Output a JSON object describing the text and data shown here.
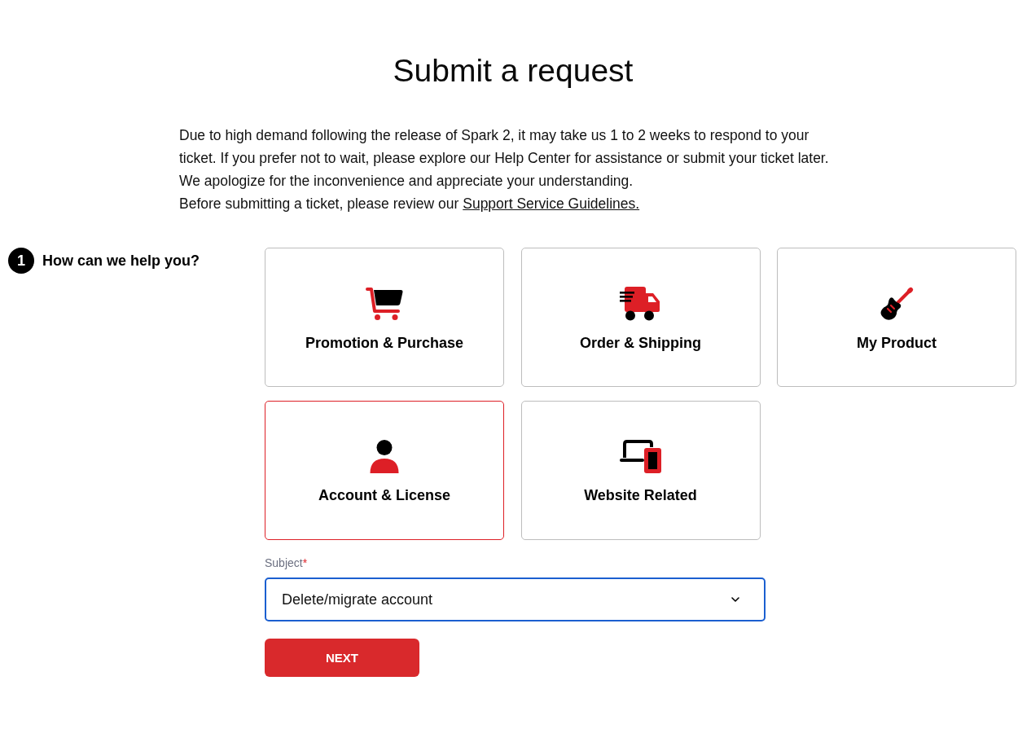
{
  "page": {
    "title": "Submit a request"
  },
  "notice": {
    "paragraphs": [
      "Due to high demand following the release of Spark 2, it may take us 1 to 2 weeks to respond to your ticket. If you prefer not to wait, please explore our Help Center for assistance or submit your ticket later.",
      "We apologize for the inconvenience and appreciate your understanding."
    ],
    "guidelines": {
      "text": "Before submitting a ticket, please review our ",
      "link": "Support Service Guidelines."
    }
  },
  "step": {
    "number": "1",
    "label": "How can we help you?"
  },
  "categories": [
    {
      "label": "Promotion & Purchase",
      "kind": "cart",
      "selected": false
    },
    {
      "label": "Order & Shipping",
      "kind": "truck",
      "selected": false
    },
    {
      "label": "My Product",
      "kind": "guitar",
      "selected": false
    },
    {
      "label": "Account & License",
      "kind": "person",
      "selected": true
    },
    {
      "label": "Website Related",
      "kind": "devices",
      "selected": false
    }
  ],
  "subject": {
    "label": "Subject",
    "required_mark": "*",
    "value": "Delete/migrate account",
    "focused": true
  },
  "next_button": {
    "label": "NEXT"
  }
}
